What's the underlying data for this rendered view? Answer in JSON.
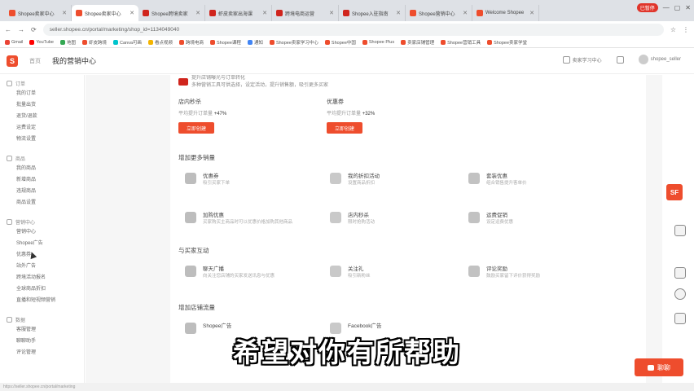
{
  "browser": {
    "tabs": [
      {
        "label": "Shopee卖家中心",
        "color": "#ee4d2d",
        "active": false
      },
      {
        "label": "Shopee卖家中心",
        "color": "#ee4d2d",
        "active": true
      },
      {
        "label": "Shopee跨境卖家",
        "color": "#d0251d",
        "active": false
      },
      {
        "label": "虾皮卖家出海课",
        "color": "#d0251d",
        "active": false
      },
      {
        "label": "跨境电商运营",
        "color": "#d0251d",
        "active": false
      },
      {
        "label": "Shopee入驻指南",
        "color": "#d0251d",
        "active": false
      },
      {
        "label": "Shopee营销中心",
        "color": "#ee4d2d",
        "active": false
      },
      {
        "label": "Welcome Shopee",
        "color": "#ee4d2d",
        "active": false
      }
    ],
    "window_badge": "已暂停",
    "url": "seller.shopee.cn/portal/marketing/shop_id=1134049040",
    "bookmarks": [
      "Gmail",
      "YouTube",
      "地图",
      "虾皮跨境",
      "Canva可画",
      "看点视频",
      "跨境电商",
      "Shopee课程",
      "通知",
      "Shopee卖家学习中心",
      "Shopee中国",
      "Shopee Plus",
      "卖家店铺管理",
      "Shopee营销工具",
      "Shopee卖家学堂"
    ]
  },
  "header": {
    "logo": "S",
    "home": "首页",
    "title": "我的营销中心",
    "help": "卖家学习中心",
    "user": "shopee_seller"
  },
  "sidebar": {
    "groups": [
      {
        "head": "订单",
        "items": [
          "我的订单",
          "批量出货",
          "退货/退款",
          "运费设定",
          "物流设置"
        ]
      },
      {
        "head": "商品",
        "items": [
          "我的商品",
          "新增商品",
          "违规商品",
          "商品设置"
        ]
      },
      {
        "head": "营销中心",
        "items": [
          "营销中心",
          "Shopee广告",
          "优惠券",
          "站外广告",
          "跨境活动报名",
          "全球商品折扣",
          "直播和短视频营销"
        ]
      },
      {
        "head": "数据",
        "items": [
          "客服管理",
          "聊聊助手",
          "评论管理"
        ]
      }
    ]
  },
  "main": {
    "banner_line1": "提升店铺曝光与订单转化",
    "banner_line2": "多种营销工具可供选择，设定活动，提升销售额，吸引更多买家",
    "promos": [
      {
        "title": "店内秒杀",
        "stat_prefix": "平均提升订单量",
        "stat": "+47%",
        "button": "立即创建"
      },
      {
        "title": "优惠券",
        "stat_prefix": "平均提升订单量",
        "stat": "+32%",
        "button": "立即创建"
      }
    ],
    "sections": [
      {
        "title": "增加更多销量",
        "features": [
          {
            "name": "优惠券",
            "desc": "吸引买家下单"
          },
          {
            "name": "我的折扣活动",
            "desc": "设置商品折扣"
          },
          {
            "name": "套装优惠",
            "desc": "组合销售提升客单价"
          },
          {
            "name": "加购优惠",
            "desc": "买家购买主商品时可以优惠价格加购其他商品"
          },
          {
            "name": "店内秒杀",
            "desc": "限时抢购活动"
          },
          {
            "name": "运费促销",
            "desc": "设定运费优惠"
          }
        ]
      },
      {
        "title": "与买家互动",
        "features": [
          {
            "name": "聊天广播",
            "desc": "向关注您店铺的买家发送讯息与优惠"
          },
          {
            "name": "关注礼",
            "desc": "吸引新粉丝"
          },
          {
            "name": "评论奖励",
            "desc": "鼓励买家留下评价获得奖励"
          }
        ]
      },
      {
        "title": "增加店铺流量",
        "features": [
          {
            "name": "Shopee广告",
            "desc": ""
          },
          {
            "name": "Facebook广告",
            "desc": ""
          }
        ]
      }
    ]
  },
  "rail": {
    "badge": "SF"
  },
  "chat": {
    "label": "聊聊"
  },
  "subtitle": "希望对你有所帮助",
  "status": "https://seller.shopee.cn/portal/marketing"
}
